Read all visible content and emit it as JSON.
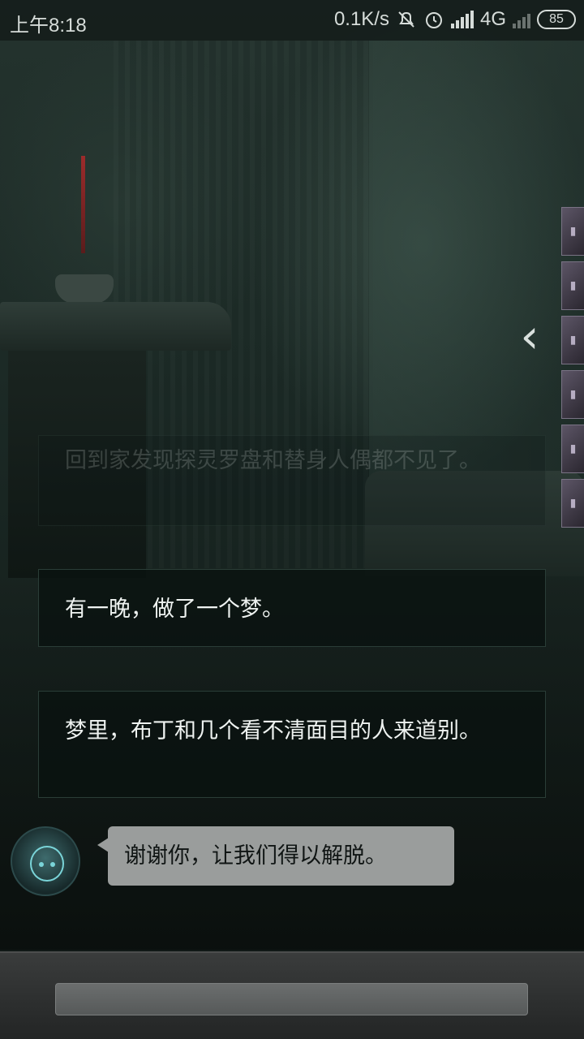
{
  "status_bar": {
    "time": "上午8:18",
    "net_speed": "0.1K/s",
    "network_type": "4G",
    "battery": "85",
    "icons": [
      "mute-bell-icon",
      "alarm-icon",
      "signal-icon",
      "signal-icon"
    ]
  },
  "dialogs": [
    {
      "text": "回到家发现探灵罗盘和替身人偶都不见了。",
      "faded": true
    },
    {
      "text": "有一晚，做了一个梦。",
      "faded": false
    },
    {
      "text": "梦里，布丁和几个看不清面目的人来道别。",
      "faded": false
    }
  ],
  "speech": {
    "text": "谢谢你，让我们得以解脱。"
  },
  "side_panel": {
    "toggle_icon": "chevron-left-icon",
    "items": [
      "item-card",
      "item-card",
      "item-card",
      "item-card",
      "item-card",
      "item-card"
    ]
  },
  "colors": {
    "bubble": "#9a9d9c",
    "dialog_bg": "#0a1210",
    "text": "#eef2f0"
  }
}
